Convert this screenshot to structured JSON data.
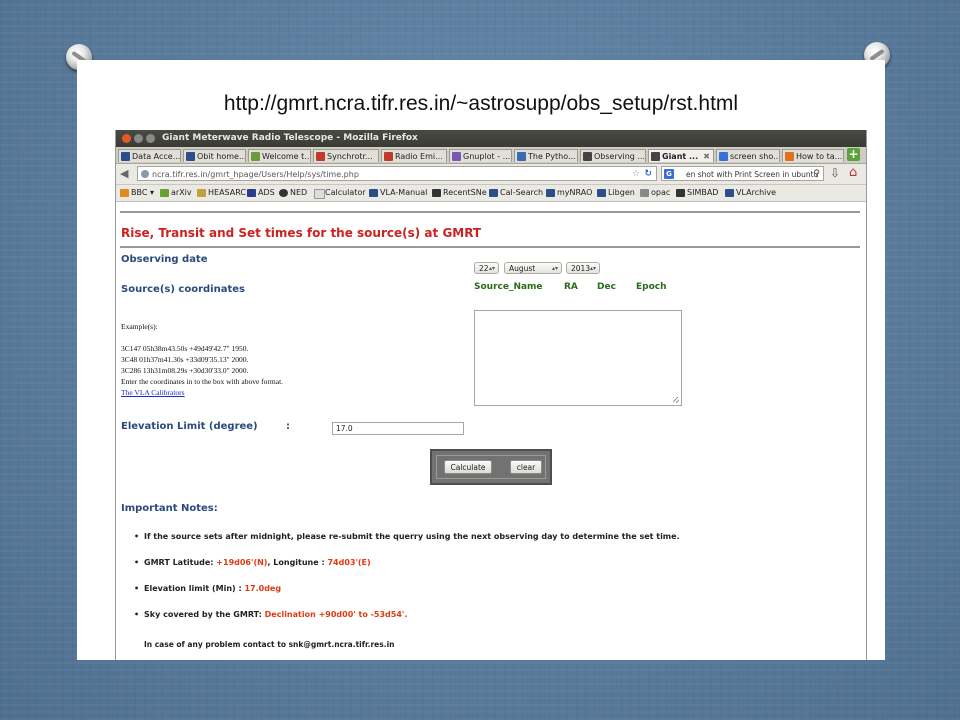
{
  "slide": {
    "url_caption": "http://gmrt.ncra.tifr.res.in/~astrosupp/obs_setup/rst.html"
  },
  "window": {
    "title": "Giant Meterwave Radio Telescope - Mozilla Firefox"
  },
  "tabs": [
    {
      "label": "Data Acce...",
      "icon_color": "#2b4e8c"
    },
    {
      "label": "Obit home...",
      "icon_color": "#2b4e8c"
    },
    {
      "label": "Welcome t...",
      "icon_color": "#6a9a3a"
    },
    {
      "label": "Synchrotr...",
      "icon_color": "#c03a2a"
    },
    {
      "label": "Radio Emi...",
      "icon_color": "#c03a2a"
    },
    {
      "label": "Gnuplot - ...",
      "icon_color": "#7a5ab0"
    },
    {
      "label": "The Pytho...",
      "icon_color": "#3a6ab0"
    },
    {
      "label": "Observing ...",
      "icon_color": "#444444"
    },
    {
      "label": "Giant ...",
      "icon_color": "#444444",
      "active": true
    },
    {
      "label": "screen sho...",
      "icon_color": "#3b6fd8"
    },
    {
      "label": "How to ta...",
      "icon_color": "#e07020"
    }
  ],
  "navbar": {
    "url": "ncra.tifr.res.in/gmrt_hpage/Users/Help/sys/time.php",
    "url_host": "ncra.tifr.res.in",
    "search_text": "en shot with Print Screen in ubuntu",
    "search_engine_icon": "G"
  },
  "bookmarks": [
    {
      "label": "BBC",
      "icon_color": "#e08a20"
    },
    {
      "label": "arXiv",
      "icon_color": "#6aa030"
    },
    {
      "label": "HEASARC",
      "icon_color": "#c0a040"
    },
    {
      "label": "ADS",
      "icon_color": "#2a3a8c"
    },
    {
      "label": "NED",
      "icon_color": "#333333"
    },
    {
      "label": "Calculator",
      "icon_color": "#dddddd"
    },
    {
      "label": "VLA-Manual",
      "icon_color": "#2b4e8c"
    },
    {
      "label": "RecentSNe",
      "icon_color": "#333333"
    },
    {
      "label": "Cal-Search",
      "icon_color": "#2b4e8c"
    },
    {
      "label": "myNRAO",
      "icon_color": "#2b4e8c"
    },
    {
      "label": "Libgen",
      "icon_color": "#2b4e8c"
    },
    {
      "label": "opac",
      "icon_color": "#888888"
    },
    {
      "label": "SIMBAD",
      "icon_color": "#333333"
    },
    {
      "label": "VLArchive",
      "icon_color": "#2b4e8c"
    }
  ],
  "page": {
    "title": "Rise, Transit and Set times for the source(s) at GMRT",
    "observing_date_label": "Observing date",
    "day": "22",
    "month": "August",
    "year": "2013",
    "sources_label": "Source(s) coordinates",
    "columns": [
      "Source_Name",
      "RA",
      "Dec",
      "Epoch"
    ],
    "example_heading": "Example(s):",
    "examples": [
      "3C147 05h38m43.50s +49d49'42.7\" 1950.",
      "3C48 01h37m41.30s +33d09'35.13\" 2000.",
      "3C286 13h31m08.29s +30d30'33.0\" 2000.",
      "Enter the coordinates in to the box with above format."
    ],
    "calibrators_link": "The VLA Calibrators",
    "elevation_label": "Elevation Limit (degree)",
    "elevation_colon": ":",
    "elevation_value": "17.0",
    "calculate_label": "Calculate",
    "clear_label": "clear",
    "notes_heading": "Important Notes:",
    "notes": [
      {
        "text": "If the source sets after midnight, please re-submit the querry using the next observing day to determine the set time."
      },
      {
        "prefix": "GMRT Latitude: ",
        "red1": "+19d06'(N)",
        "mid": ", Longitune : ",
        "red2": "74d03'(E)"
      },
      {
        "prefix": "Elevation limit (Min) : ",
        "red1": "17.0deg"
      },
      {
        "prefix": "Sky covered by the GMRT: ",
        "red1": "Declination +90d00' to -53d54'."
      }
    ],
    "contact": "In case of any problem contact to snk@gmrt.ncra.tifr.res.in"
  }
}
